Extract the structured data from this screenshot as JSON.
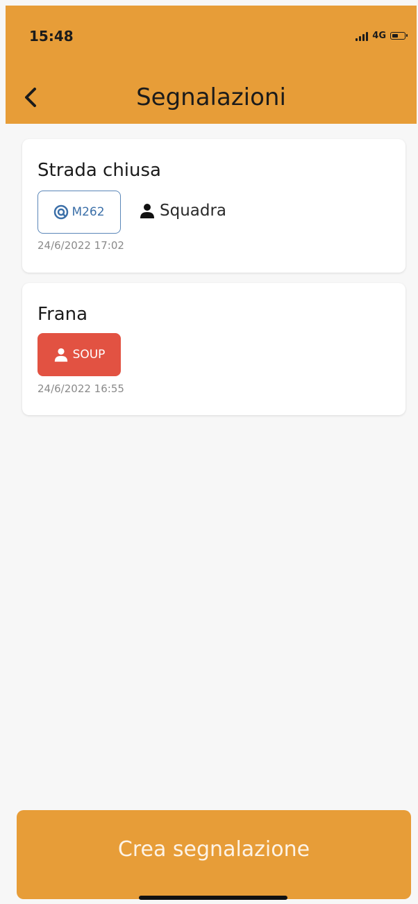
{
  "status_bar": {
    "time": "15:48",
    "network": "4G",
    "battery_level": 0.55,
    "signal_bars": 4
  },
  "header": {
    "title": "Segnalazioni",
    "back_icon": "chevron-left-icon"
  },
  "colors": {
    "accent": "#e79d38",
    "tag_blue": "#3b6fa8",
    "tag_red": "#e25242"
  },
  "reports": [
    {
      "title": "Strada chiusa",
      "tag": {
        "label": "M262",
        "icon": "target-icon",
        "style": "outline"
      },
      "assignee": {
        "label": "Squadra",
        "icon": "person-icon"
      },
      "date": "24/6/2022 17:02"
    },
    {
      "title": "Frana",
      "tag": {
        "label": "SOUP",
        "icon": "person-icon",
        "style": "red"
      },
      "date": "24/6/2022 16:55"
    }
  ],
  "footer": {
    "create_label": "Crea segnalazione"
  }
}
